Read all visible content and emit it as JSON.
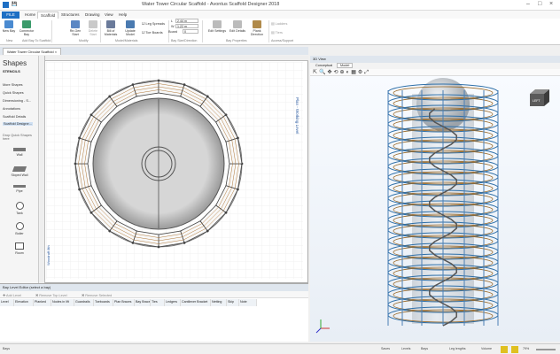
{
  "window": {
    "title": "Water Tower Circular Scaffold - Avontus Scaffold Designer 2018"
  },
  "ribbon_tabs": [
    "FILE",
    "Home",
    "Scaffold",
    "Structures",
    "Drawing",
    "View",
    "Help"
  ],
  "ribbon": {
    "buttons": [
      "New Bay",
      "Connector Bay",
      "Re-Gen Start",
      "Delete Start",
      "Bill of Materials",
      "Update Model"
    ],
    "checks": [
      "Leg Spreads",
      "Toe Boards"
    ],
    "fields": [
      {
        "label": "L",
        "value": "2.44 m"
      },
      {
        "label": "W",
        "value": "1.22 m"
      },
      {
        "label": "Board",
        "value": "0"
      }
    ],
    "right_buttons": [
      "Edit Settings",
      "Edit Details",
      "Plank Direction"
    ],
    "right_small": [
      "Ladders",
      "Tiers"
    ],
    "groups": [
      "New",
      "Add Bay To Scaffold",
      "Modify",
      "Model/Materials",
      "Bay Size/Direction",
      "Bay Properties",
      "Access/Support"
    ]
  },
  "doc_tab": "Water Tower Circular Scaffold",
  "shapes": {
    "title": "Shapes",
    "stencils": "STENCILS",
    "items": [
      "More Shapes",
      "Quick Shapes",
      "Dimensioning - S...",
      "Annotations",
      "Scaffold Details",
      "Scaffold Designe..."
    ],
    "drop": "Drop Quick Shapes here",
    "stencil_items": [
      "Wall",
      "Sloped Wall",
      "Pipe",
      "Tank",
      "Boiler",
      "Room"
    ]
  },
  "plan": {
    "side_label": "Plan - Working Level",
    "bottom_label": "Woodruff 8th"
  },
  "view3d": {
    "header": "3D View",
    "tabs": [
      "Conceptual",
      "Model"
    ],
    "cube_label": "LEFT"
  },
  "level_editor": {
    "title": "Bay Level Editor (select a bay)",
    "buttons": [
      "Add Level",
      "Remove Top Level",
      "Remove Selected"
    ],
    "columns": [
      "Level",
      "Elevation",
      "Planked",
      "Nodes in lift",
      "Guardrails",
      "Toeboards",
      "Plan Braces",
      "Bay Brace",
      "Ties",
      "Ledgers",
      "Cantilever Bracket",
      "Netting",
      "Skip",
      "Note"
    ]
  },
  "status": {
    "left": "Bays",
    "items": [
      "Saves",
      "Levels",
      "Bays",
      "Leg lengths",
      "Volume"
    ],
    "zoom": "79%"
  },
  "colors": {
    "accent": "#1e6fc4",
    "scaffold": "#2e6fa8",
    "plank": "#9a6a2a",
    "tank": "#c8c8c8"
  }
}
